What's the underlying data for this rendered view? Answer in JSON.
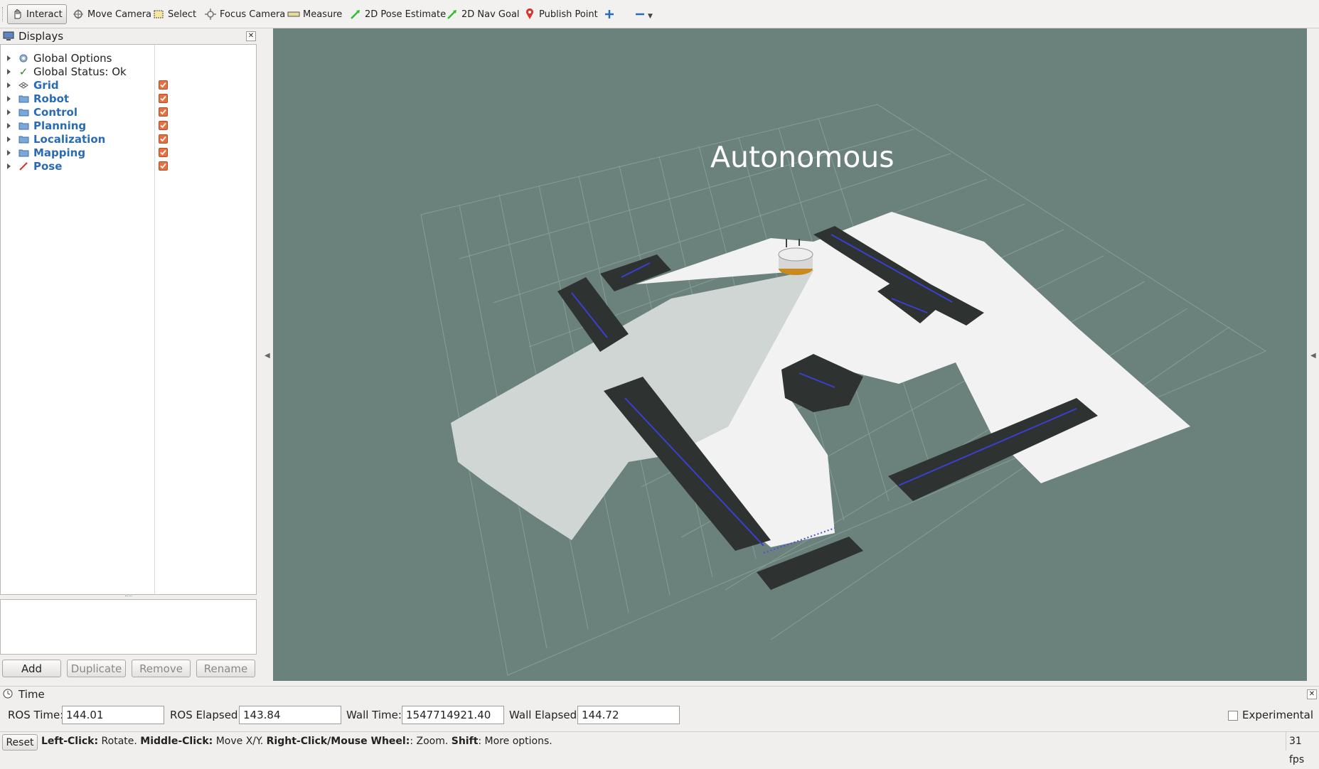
{
  "toolbar": {
    "interact": "Interact",
    "move_camera": "Move Camera",
    "select": "Select",
    "focus_camera": "Focus Camera",
    "measure": "Measure",
    "pose_estimate": "2D Pose Estimate",
    "nav_goal": "2D Nav Goal",
    "publish_point": "Publish Point"
  },
  "displays": {
    "title": "Displays",
    "items": [
      {
        "label": "Global Options",
        "icon": "gear-icon"
      },
      {
        "label": "Global Status: Ok",
        "icon": "check-icon"
      },
      {
        "label": "Grid",
        "icon": "grid-icon",
        "checked": true
      },
      {
        "label": "Robot",
        "icon": "folder-icon",
        "checked": true
      },
      {
        "label": "Control",
        "icon": "folder-icon",
        "checked": true
      },
      {
        "label": "Planning",
        "icon": "folder-icon",
        "checked": true
      },
      {
        "label": "Localization",
        "icon": "folder-icon",
        "checked": true
      },
      {
        "label": "Mapping",
        "icon": "folder-icon",
        "checked": true
      },
      {
        "label": "Pose",
        "icon": "arrow-icon",
        "checked": true
      }
    ],
    "buttons": {
      "add": "Add",
      "duplicate": "Duplicate",
      "remove": "Remove",
      "rename": "Rename"
    }
  },
  "view": {
    "overlay_text": "Autonomous",
    "background_color": "#6a817c"
  },
  "time": {
    "title": "Time",
    "ros_time_label": "ROS Time:",
    "ros_time": "144.01",
    "ros_elapsed_label": "ROS Elapsed:",
    "ros_elapsed": "143.84",
    "wall_time_label": "Wall Time:",
    "wall_time": "1547714921.40",
    "wall_elapsed_label": "Wall Elapsed:",
    "wall_elapsed": "144.72",
    "experimental_label": "Experimental"
  },
  "status": {
    "reset": "Reset",
    "left_click": "Left-Click:",
    "left_desc": " Rotate. ",
    "middle_click": "Middle-Click:",
    "middle_desc": " Move X/Y. ",
    "right_click": "Right-Click/Mouse Wheel:",
    "right_desc": ": Zoom. ",
    "shift": "Shift",
    "shift_desc": ": More options.",
    "fps": "31 fps"
  },
  "colors": {
    "accent_blue": "#2a6bb5",
    "checkbox_orange": "#e8703f"
  }
}
